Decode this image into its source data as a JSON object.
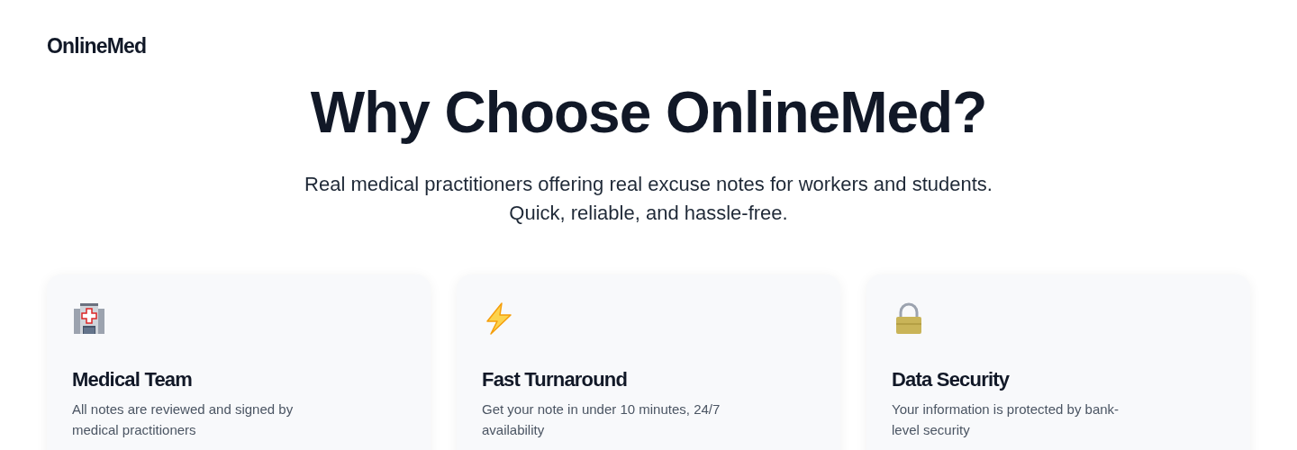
{
  "brand": "OnlineMed",
  "hero": {
    "title": "Why Choose OnlineMed?",
    "subtitle": "Real medical practitioners offering real excuse notes for workers and students. Quick, reliable, and hassle-free."
  },
  "features": [
    {
      "title": "Medical Team",
      "description": "All notes are reviewed and signed by medical practitioners"
    },
    {
      "title": "Fast Turnaround",
      "description": "Get your note in under 10 minutes, 24/7 availability"
    },
    {
      "title": "Data Security",
      "description": "Your information is protected by bank-level security"
    }
  ]
}
